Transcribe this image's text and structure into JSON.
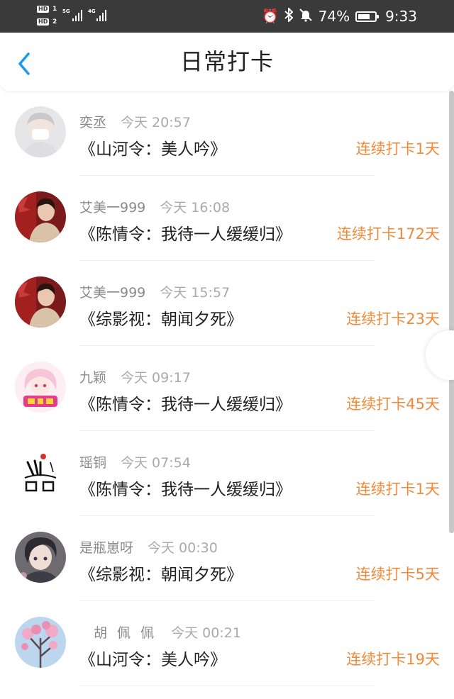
{
  "status_bar": {
    "hd1": "HD",
    "sim1": "1",
    "hd2": "HD",
    "sim2": "2",
    "net1": "5G",
    "net2": "4G",
    "battery_percent": 74,
    "battery_text": "74%",
    "time": "9:33",
    "icons": [
      "alarm-icon",
      "bluetooth-icon",
      "mute-icon",
      "battery-icon"
    ]
  },
  "header": {
    "title": "日常打卡",
    "back_icon": "chevron-left-icon",
    "accent": "#1a9bea"
  },
  "colors": {
    "streak": "#f08a3a",
    "name": "#8a8a8a",
    "book": "#222222"
  },
  "checkins": [
    {
      "name": "奕丞",
      "time": "今天 20:57",
      "book": "《山河令：美人吟》",
      "streak": "连续打卡1天",
      "avatar": "avatar-masked-person"
    },
    {
      "name": "艾美一999",
      "time": "今天 16:08",
      "book": "《陈情令：我待一人缓缓归》",
      "streak": "连续打卡172天",
      "avatar": "avatar-red-portrait"
    },
    {
      "name": "艾美一999",
      "time": "今天 15:57",
      "book": "《综影视：朝闻夕死》",
      "streak": "连续打卡23天",
      "avatar": "avatar-red-portrait"
    },
    {
      "name": "九颖",
      "time": "今天 09:17",
      "book": "《陈情令：我待一人缓缓归》",
      "streak": "连续打卡45天",
      "avatar": "avatar-anime-girl"
    },
    {
      "name": "瑶铜",
      "time": "今天 07:54",
      "book": "《陈情令：我待一人缓缓归》",
      "streak": "连续打卡1天",
      "avatar": "avatar-ink-calligraphy"
    },
    {
      "name": "是瓶崽呀",
      "time": "今天 00:30",
      "book": "《综影视：朝闻夕死》",
      "streak": "连续打卡5天",
      "avatar": "avatar-anime-boy"
    },
    {
      "name": "胡 佩 佩",
      "time": "今天 00:21",
      "book": "《山河令：美人吟》",
      "streak": "连续打卡19天",
      "avatar": "avatar-blossom-tree"
    }
  ]
}
